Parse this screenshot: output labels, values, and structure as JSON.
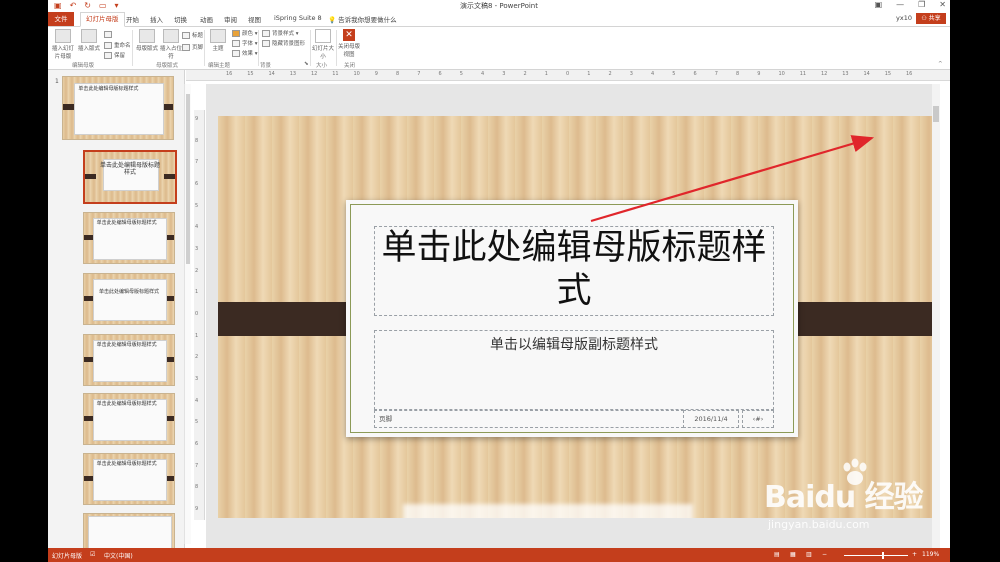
{
  "window": {
    "title": "演示文稿8 - PowerPoint",
    "user": "yx10",
    "share": "共享"
  },
  "tabs": [
    "文件",
    "幻灯片母版",
    "开始",
    "插入",
    "切换",
    "动画",
    "审阅",
    "视图",
    "iSpring Suite 8"
  ],
  "tell_me": "告诉我你想要做什么",
  "ribbon": {
    "insert_master": "插入幻灯片母版",
    "insert_layout": "插入版式",
    "rename": "重命名",
    "preserve": "保留",
    "master_layout": "母版版式",
    "insert_placeholder": "插入占位符",
    "title_check": "标题",
    "footer_check": "页脚",
    "themes": "主题",
    "colors": "颜色",
    "fonts": "字体",
    "effects": "效果",
    "bg_styles": "背景样式",
    "hide_bg": "隐藏背景图形",
    "slide_size": "幻灯片大小",
    "close_master": "关闭母版视图",
    "groups": {
      "edit_master": "编辑母版",
      "master_layout": "母版版式",
      "edit_theme": "编辑主题",
      "background": "背景",
      "size": "大小",
      "close": "关闭"
    }
  },
  "ruler_ticks": [
    "16",
    "15",
    "14",
    "13",
    "12",
    "11",
    "10",
    "9",
    "8",
    "7",
    "6",
    "5",
    "4",
    "3",
    "2",
    "1",
    "0",
    "1",
    "2",
    "3",
    "4",
    "5",
    "6",
    "7",
    "8",
    "9",
    "10",
    "11",
    "12",
    "13",
    "14",
    "15",
    "16"
  ],
  "vruler_ticks": [
    "9",
    "8",
    "7",
    "6",
    "5",
    "4",
    "3",
    "2",
    "1",
    "0",
    "1",
    "2",
    "3",
    "4",
    "5",
    "6",
    "7",
    "8",
    "9"
  ],
  "thumbnails": {
    "number": "1",
    "items": [
      "单击此处编辑母版标题样式",
      "单击此处编辑母版标题样式",
      "单击此处编辑母版标题样式",
      "单击此处编辑母版标题样式",
      "单击此处编辑母版标题样式",
      "单击此处编辑母版标题样式",
      "单击此处编辑母版标题样式",
      ""
    ]
  },
  "slide": {
    "title": "单击此处编辑母版标题样式",
    "subtitle": "单击以编辑母版副标题样式",
    "footer": "页脚",
    "date": "2016/11/4",
    "number": "‹#›"
  },
  "status": {
    "view": "幻灯片母版",
    "language": "中文(中国)",
    "zoom": "119%",
    "zoom_fraction": 0.6
  },
  "watermark": {
    "logo": "Baidu 经验",
    "url": "jingyan.baidu.com"
  },
  "colors": {
    "accent": "#c43e1c",
    "arrow": "#e0262b",
    "band": "#3b2a22",
    "frame": "#8c9a57"
  }
}
